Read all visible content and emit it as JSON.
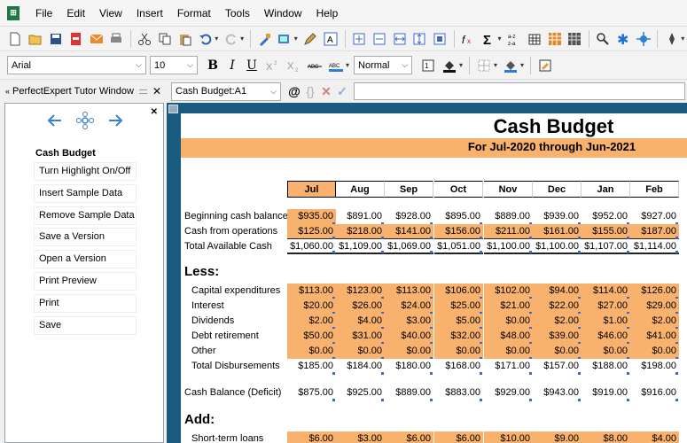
{
  "menu": [
    "File",
    "Edit",
    "View",
    "Insert",
    "Format",
    "Tools",
    "Window",
    "Help"
  ],
  "format_bar": {
    "font": "Arial",
    "size": "10",
    "style": "Normal",
    "bold": "B",
    "italic": "I",
    "underline": "U"
  },
  "tutor_pane": {
    "title": "PerfectExpert Tutor Window",
    "heading": "Cash Budget",
    "links": [
      "Turn Highlight On/Off",
      "Insert Sample Data",
      "Remove Sample Data",
      "Save a Version",
      "Open a Version",
      "Print Preview",
      "Print",
      "Save"
    ]
  },
  "formula_bar": {
    "cell_ref": "Cash Budget:A1",
    "at": "@",
    "braces": "{}",
    "cancel": "✕",
    "accept": "✓",
    "content": ""
  },
  "sheet": {
    "title": "Cash Budget",
    "subtitle": "For Jul-2020 through Jun-2021",
    "months": [
      "Jul",
      "Aug",
      "Sep",
      "Oct",
      "Nov",
      "Dec",
      "Jan",
      "Feb"
    ],
    "less_label": "Less:",
    "add_label": "Add:",
    "rows": [
      {
        "label": "Beginning cash balance",
        "values": [
          "$935.00",
          "$891.00",
          "$928.00",
          "$895.00",
          "$889.00",
          "$939.00",
          "$952.00",
          "$927.00"
        ]
      },
      {
        "label": "Cash from operations",
        "values": [
          "$125.00",
          "$218.00",
          "$141.00",
          "$156.00",
          "$211.00",
          "$161.00",
          "$155.00",
          "$187.00"
        ]
      },
      {
        "label": "Total Available Cash",
        "values": [
          "$1,060.00",
          "$1,109.00",
          "$1,069.00",
          "$1,051.00",
          "$1,100.00",
          "$1,100.00",
          "$1,107.00",
          "$1,114.00"
        ]
      },
      {
        "label": "Capital expenditures",
        "values": [
          "$113.00",
          "$123.00",
          "$113.00",
          "$106.00",
          "$102.00",
          "$94.00",
          "$114.00",
          "$126.00"
        ]
      },
      {
        "label": "Interest",
        "values": [
          "$20.00",
          "$26.00",
          "$24.00",
          "$25.00",
          "$21.00",
          "$22.00",
          "$27.00",
          "$29.00"
        ]
      },
      {
        "label": "Dividends",
        "values": [
          "$2.00",
          "$4.00",
          "$3.00",
          "$5.00",
          "$0.00",
          "$2.00",
          "$1.00",
          "$2.00"
        ]
      },
      {
        "label": "Debt retirement",
        "values": [
          "$50.00",
          "$31.00",
          "$40.00",
          "$32.00",
          "$48.00",
          "$39.00",
          "$46.00",
          "$41.00"
        ]
      },
      {
        "label": "Other",
        "values": [
          "$0.00",
          "$0.00",
          "$0.00",
          "$0.00",
          "$0.00",
          "$0.00",
          "$0.00",
          "$0.00"
        ]
      },
      {
        "label": "Total Disbursements",
        "values": [
          "$185.00",
          "$184.00",
          "$180.00",
          "$168.00",
          "$171.00",
          "$157.00",
          "$188.00",
          "$198.00"
        ]
      },
      {
        "label": "Cash Balance (Deficit)",
        "values": [
          "$875.00",
          "$925.00",
          "$889.00",
          "$883.00",
          "$929.00",
          "$943.00",
          "$919.00",
          "$916.00"
        ]
      },
      {
        "label": "Short-term loans",
        "values": [
          "$6.00",
          "$3.00",
          "$6.00",
          "$6.00",
          "$10.00",
          "$9.00",
          "$8.00",
          "$4.00"
        ]
      }
    ]
  },
  "colors": {
    "accent_orange": "#f9b16e",
    "sheet_frame": "#1a5b80"
  }
}
